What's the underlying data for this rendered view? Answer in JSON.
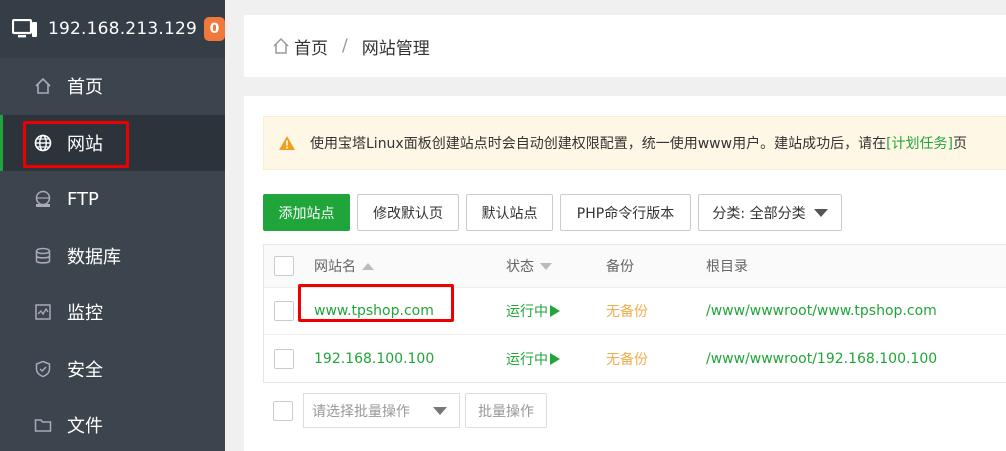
{
  "header": {
    "ip": "192.168.213.129",
    "badge": "0"
  },
  "sidebar": {
    "items": [
      {
        "label": "首页",
        "icon": "home-icon"
      },
      {
        "label": "网站",
        "icon": "globe-icon",
        "active": true
      },
      {
        "label": "FTP",
        "icon": "ftp-icon"
      },
      {
        "label": "数据库",
        "icon": "database-icon"
      },
      {
        "label": "监控",
        "icon": "monitor-icon"
      },
      {
        "label": "安全",
        "icon": "shield-icon"
      },
      {
        "label": "文件",
        "icon": "folder-icon"
      }
    ]
  },
  "breadcrumb": {
    "home": "首页",
    "sep": "/",
    "current": "网站管理"
  },
  "notice": {
    "text": "使用宝塔Linux面板创建站点时会自动创建权限配置，统一使用www用户。建站成功后，请在",
    "link": "[计划任务]",
    "tail": "页"
  },
  "toolbar": {
    "add_site": "添加站点",
    "edit_default": "修改默认页",
    "default_site": "默认站点",
    "php_cli": "PHP命令行版本",
    "category": "分类: 全部分类"
  },
  "table": {
    "headers": {
      "name": "网站名",
      "status": "状态",
      "backup": "备份",
      "root": "根目录"
    },
    "rows": [
      {
        "name": "www.tpshop.com",
        "status": "运行中",
        "backup": "无备份",
        "root": "/www/wwwroot/www.tpshop.com"
      },
      {
        "name": "192.168.100.100",
        "status": "运行中",
        "backup": "无备份",
        "root": "/www/wwwroot/192.168.100.100"
      }
    ]
  },
  "batch": {
    "placeholder": "请选择批量操作",
    "button": "批量操作"
  },
  "colors": {
    "accent": "#20a53a",
    "sidebar": "#3c444d",
    "badge": "#f0783c",
    "highlight": "#ee0000",
    "warning": "#f0ad4e"
  }
}
